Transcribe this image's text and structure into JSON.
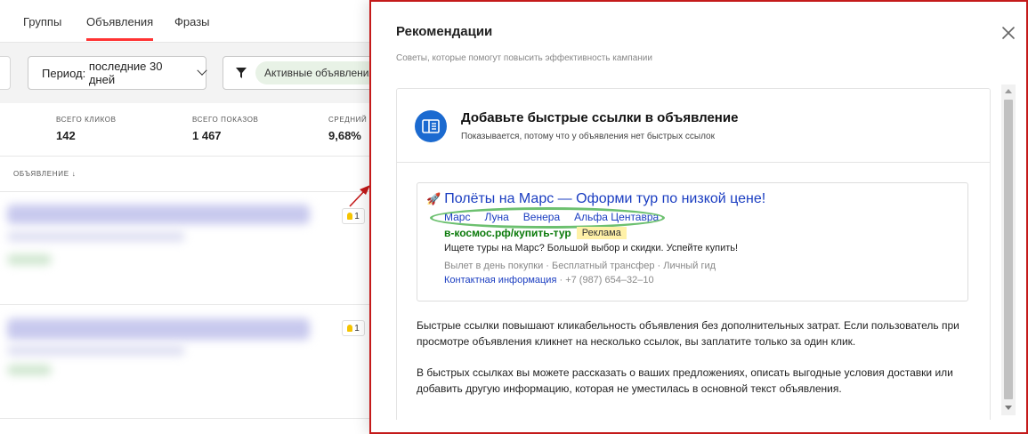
{
  "tabs": [
    {
      "label": "Группы"
    },
    {
      "label": "Объявления",
      "active": true
    },
    {
      "label": "Фразы"
    }
  ],
  "filters": {
    "period_label": "Период:",
    "period_value": "последние 30 дней",
    "status_chip": "Активные объявления"
  },
  "stats": [
    {
      "label": "всего кликов",
      "value": "142"
    },
    {
      "label": "всего показов",
      "value": "1 467"
    },
    {
      "label": "средний",
      "value": "9,68%"
    }
  ],
  "table": {
    "column_header": "объявление",
    "rows": [
      {
        "badge_count": "1"
      },
      {
        "badge_count": "1"
      }
    ]
  },
  "panel": {
    "title": "Рекомендации",
    "subtitle": "Советы, которые помогут повысить эффективность кампании",
    "card": {
      "title": "Добавьте быстрые ссылки в объявление",
      "reason": "Показывается, потому что у объявления нет быстрых ссылок",
      "ad_example": {
        "title": "Полёты на Марс — Оформи тур по низкой цене!",
        "sitelinks": [
          "Марс",
          "Луна",
          "Венера",
          "Альфа Центавра"
        ],
        "url": "в-космос.рф/купить-тур",
        "ad_mark": "Реклама",
        "text": "Ищете туры на Марс? Большой выбор и скидки. Успейте купить!",
        "features": "Вылет в день покупки · Бесплатный трансфер · Личный гид",
        "contact_link": "Контактная информация",
        "phone": "· +7 (987) 654–32–10"
      },
      "paragraph_1": "Быстрые ссылки повышают кликабельность объявления без дополнительных затрат. Если пользователь при просмотре объявления кликнет на несколько ссылок, вы заплатите только за один клик.",
      "paragraph_2": "В быстрых ссылках вы можете рассказать о ваших предложениях, описать выгодные условия доставки или добавить другую информацию, которая не уместилась в основной текст объявления."
    }
  },
  "colors": {
    "accent_red": "#c41a1a",
    "tab_underline": "#ff3333",
    "link_blue": "#1a3dc1",
    "url_green": "#0a7a0a",
    "highlight_oval": "#6cc06f",
    "icon_blue": "#1b6ad0"
  },
  "icons": {
    "close": "close-icon",
    "filter": "filter-icon",
    "sitelinks_card": "sitelinks-icon",
    "ad_favicon": "rocket-icon",
    "tip": "lightbulb-icon"
  }
}
